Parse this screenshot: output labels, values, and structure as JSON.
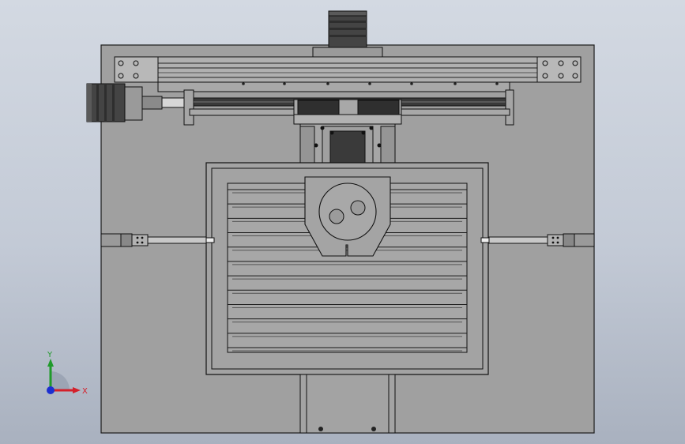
{
  "viewport": {
    "background_top": "#d3d9e2",
    "background_bottom": "#a9b1bf",
    "model_fill": "#9e9e9e",
    "model_fill_dark": "#7f7f7f",
    "line_color": "#1a1a1a"
  },
  "triad": {
    "x_label": "X",
    "y_label": "Y",
    "x_color": "#d4202a",
    "y_color": "#1f9a2a",
    "z_color": "#1c2fd0"
  },
  "icons": [
    "stepper-motor-icon",
    "coordinate-triad-icon"
  ]
}
